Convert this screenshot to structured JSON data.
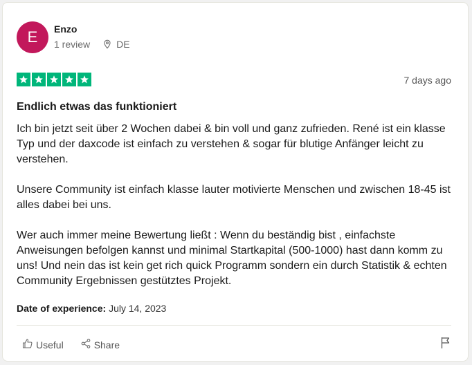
{
  "review": {
    "avatar_letter": "E",
    "user_name": "Enzo",
    "review_count": "1 review",
    "location": "DE",
    "rating": 5,
    "date_ago": "7 days ago",
    "title": "Endlich etwas das funktioniert",
    "paragraphs": [
      "Ich bin jetzt seit über 2 Wochen dabei & bin voll und ganz zufrieden. René ist ein klasse Typ und der daxcode ist einfach zu verstehen & sogar für blutige Anfänger leicht zu verstehen.",
      "Unsere Community ist einfach klasse lauter motivierte Menschen und zwischen 18-45 ist alles dabei bei uns.",
      "Wer auch immer meine Bewertung ließt : Wenn du beständig bist , einfachste Anweisungen befolgen kannst und minimal Startkapital (500-1000) hast dann komm zu uns! Und nein das ist kein get rich quick Programm sondern ein durch Statistik & echten Community Ergebnissen gestütztes Projekt."
    ],
    "experience_label": "Date of experience:",
    "experience_date": "July 14, 2023"
  },
  "actions": {
    "useful_label": "Useful",
    "share_label": "Share"
  },
  "colors": {
    "avatar_bg": "#c2185b",
    "star_green": "#00b67a"
  },
  "icons": [
    "location-pin-icon",
    "star-icon",
    "thumbs-up-icon",
    "share-icon",
    "flag-icon"
  ]
}
